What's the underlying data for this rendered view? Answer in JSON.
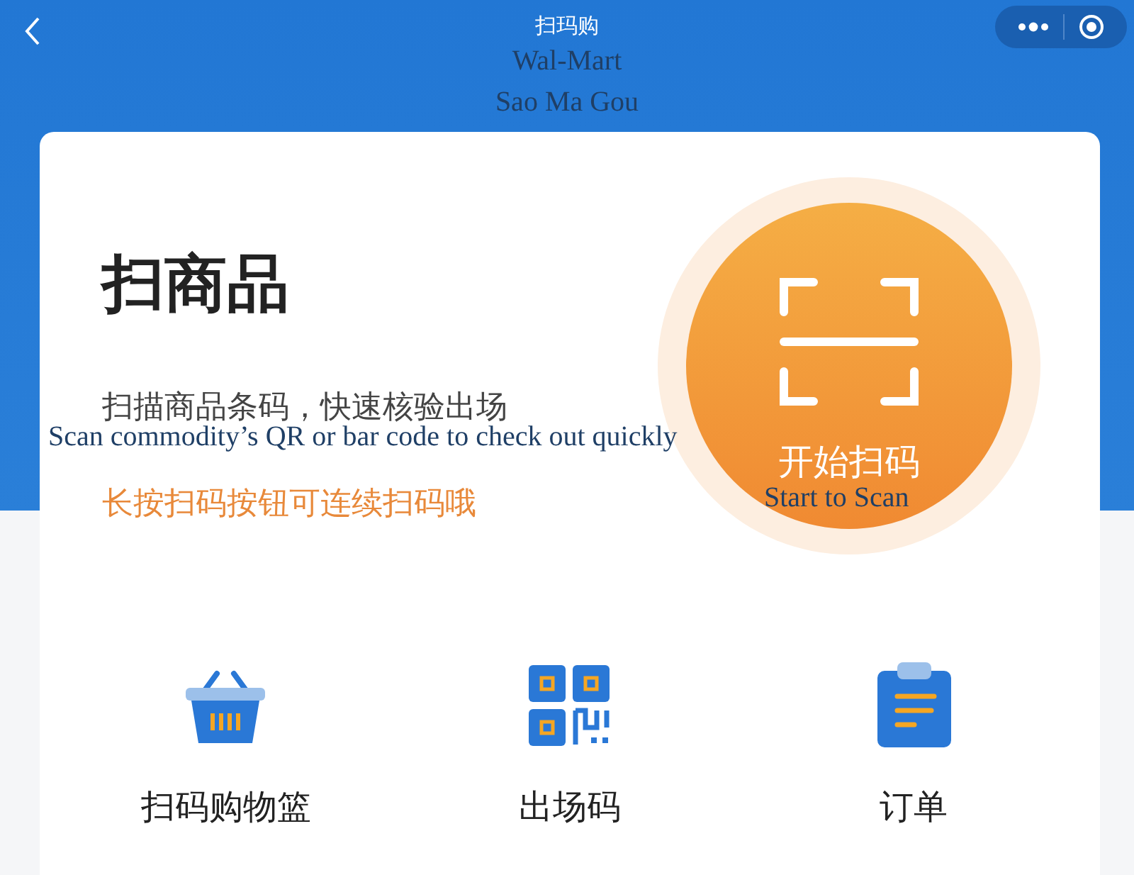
{
  "nav": {
    "title": "扫玛购"
  },
  "title_translation": [
    "Wal-Mart",
    "Sao Ma Gou"
  ],
  "hero": {
    "title": "扫商品",
    "subtitle": "扫描商品条码，快速核验出场",
    "subtitle_translation": "Scan commodity’s QR or bar code to check out quickly",
    "hint": "长按扫码按钮可连续扫码哦"
  },
  "scan_button": {
    "label": "开始扫码",
    "translation": "Start to Scan"
  },
  "shortcuts": [
    {
      "kind": "basket",
      "label": "扫码购物篮"
    },
    {
      "kind": "qrcode",
      "label": "出场码"
    },
    {
      "kind": "clipboard",
      "label": "订单"
    }
  ]
}
